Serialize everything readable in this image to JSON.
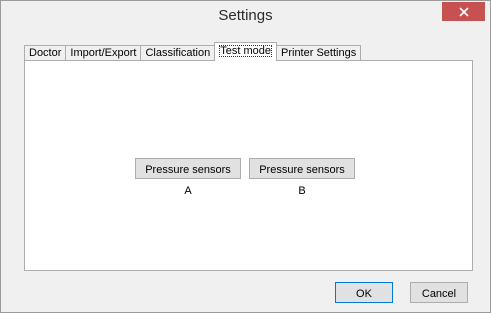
{
  "window": {
    "title": "Settings"
  },
  "tabs": [
    {
      "label": "Doctor"
    },
    {
      "label": "Import/Export"
    },
    {
      "label": "Classification"
    },
    {
      "label": "Test mode",
      "active": true
    },
    {
      "label": "Printer Settings"
    }
  ],
  "panel": {
    "button_a": "Pressure sensors A",
    "button_b": "Pressure sensors B"
  },
  "footer": {
    "ok_label": "OK",
    "cancel_label": "Cancel"
  },
  "colors": {
    "close_button": "#c75050",
    "window_bg": "#f0f0f0",
    "panel_bg": "#ffffff"
  }
}
